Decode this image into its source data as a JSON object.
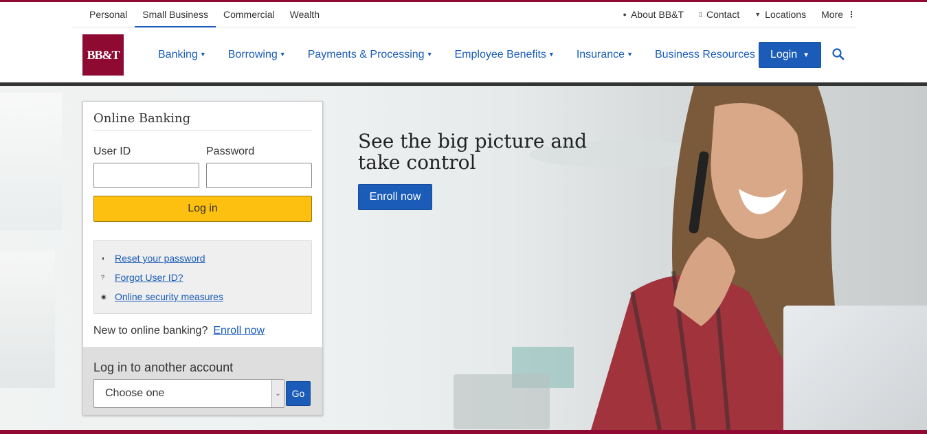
{
  "utility_nav": {
    "segments": [
      "Personal",
      "Small Business",
      "Commercial",
      "Wealth"
    ],
    "active_segment": "Small Business",
    "links": [
      {
        "label": "About BB&T",
        "icon": "person-icon"
      },
      {
        "label": "Contact",
        "icon": "phone-icon"
      },
      {
        "label": "Locations",
        "icon": "location-pin-icon"
      },
      {
        "label": "More",
        "icon": "more-dots-icon"
      }
    ]
  },
  "brand": {
    "logo_text": "BB&T",
    "color": "#8e0a33"
  },
  "main_nav": {
    "items": [
      "Banking",
      "Borrowing",
      "Payments & Processing",
      "Employee Benefits",
      "Insurance",
      "Business Resources"
    ],
    "login_label": "Login",
    "search_icon": "search-icon",
    "accent": "#1a5cb8"
  },
  "hero": {
    "headline": "See the big picture and take control",
    "cta_label": "Enroll now"
  },
  "login_card": {
    "title": "Online Banking",
    "user_id_label": "User ID",
    "user_id_value": "",
    "password_label": "Password",
    "password_value": "",
    "login_button": "Log in",
    "login_button_color": "#fdbf10",
    "help_links": [
      {
        "label": "Reset your password",
        "icon": "key-icon"
      },
      {
        "label": "Forgot User ID?",
        "icon": "question-icon"
      },
      {
        "label": "Online security measures",
        "icon": "shield-icon"
      }
    ],
    "new_to_text": "New to online banking?",
    "enroll_link": "Enroll now",
    "alt_account_title": "Log in to another account",
    "alt_account_select": "Choose one",
    "go_label": "Go"
  }
}
